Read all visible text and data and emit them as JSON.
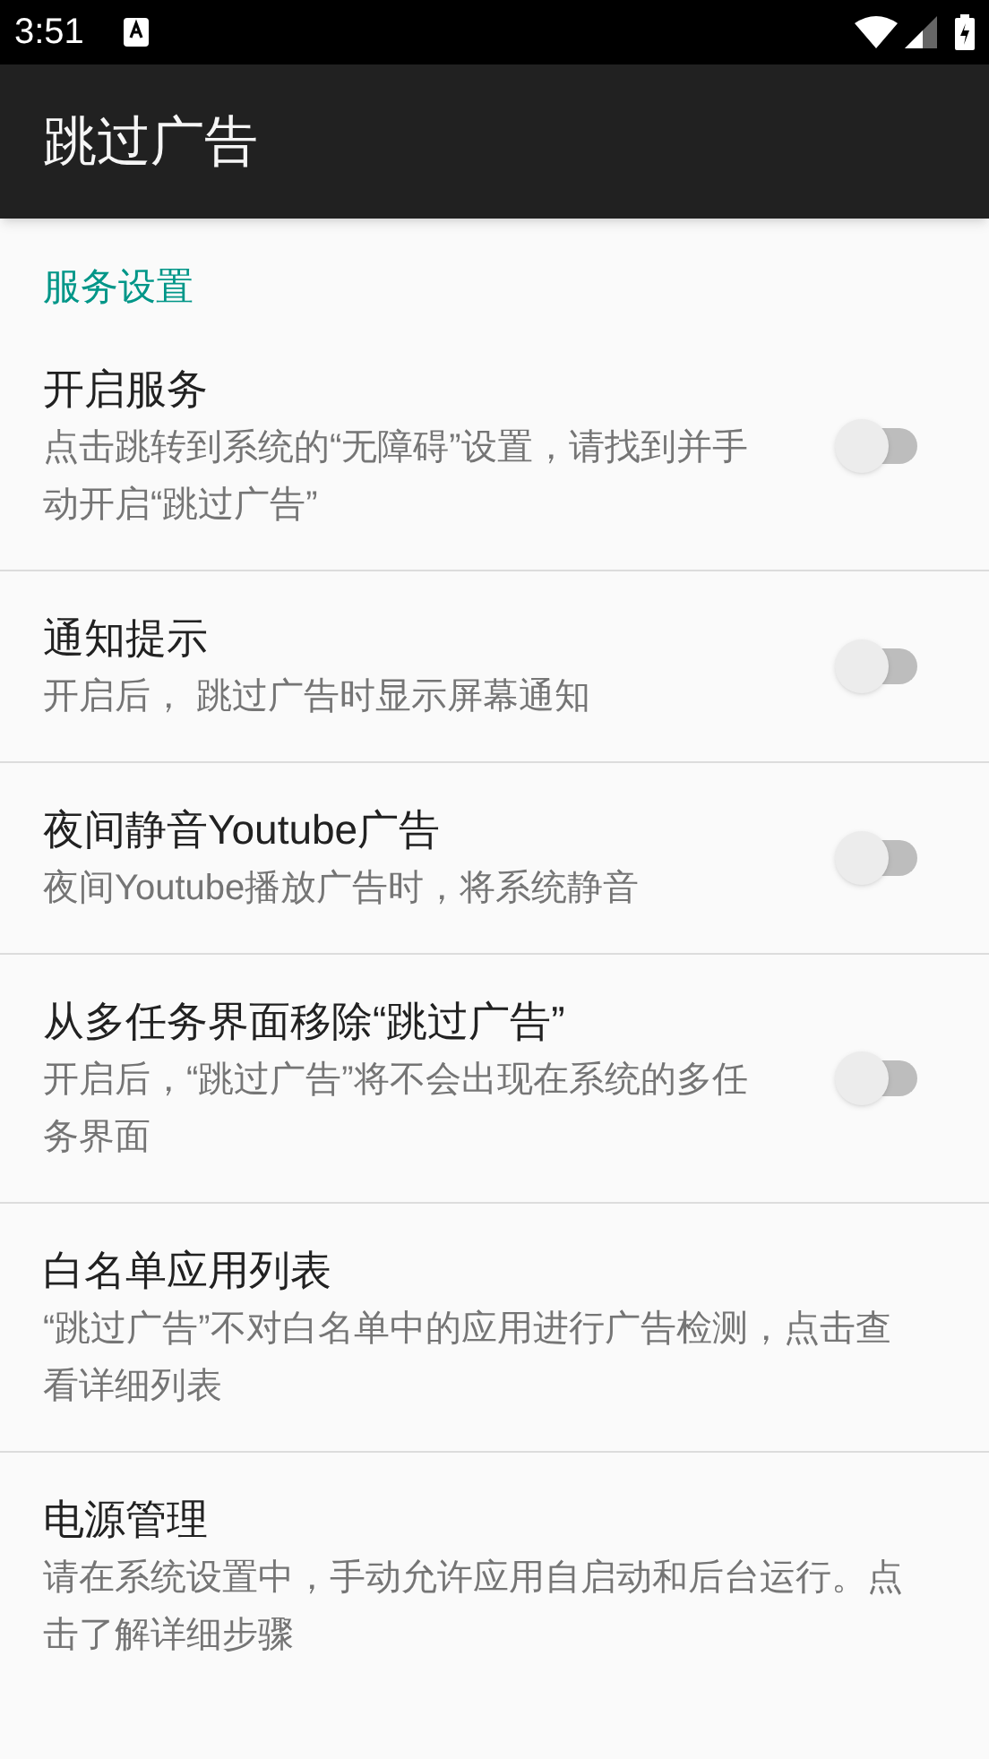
{
  "status_bar": {
    "time": "3:51"
  },
  "app_bar": {
    "title": "跳过广告"
  },
  "section": {
    "title": "服务设置"
  },
  "items": [
    {
      "kind": "switch",
      "title": "开启服务",
      "summary": "点击跳转到系统的“无障碍”设置，请找到并手动开启“跳过广告”",
      "checked": false
    },
    {
      "kind": "switch",
      "title": "通知提示",
      "summary": "开启后， 跳过广告时显示屏幕通知",
      "checked": false
    },
    {
      "kind": "switch",
      "title": "夜间静音Youtube广告",
      "summary": "夜间Youtube播放广告时，将系统静音",
      "checked": false
    },
    {
      "kind": "switch",
      "title": "从多任务界面移除“跳过广告”",
      "summary": "开启后，“跳过广告”将不会出现在系统的多任务界面",
      "checked": false
    },
    {
      "kind": "link",
      "title": "白名单应用列表",
      "summary": "“跳过广告”不对白名单中的应用进行广告检测，点击查看详细列表"
    },
    {
      "kind": "link",
      "title": "电源管理",
      "summary": "请在系统设置中，手动允许应用自启动和后台运行。点击了解详细步骤"
    }
  ]
}
